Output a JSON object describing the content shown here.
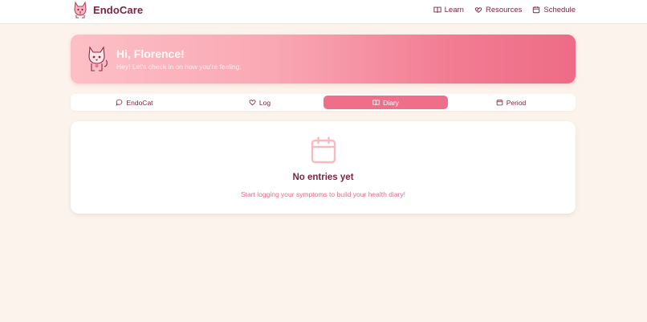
{
  "brand": {
    "name": "EndoCare"
  },
  "nav": [
    {
      "label": "Learn",
      "icon": "book-open-icon"
    },
    {
      "label": "Resources",
      "icon": "hand-heart-icon"
    },
    {
      "label": "Schedule",
      "icon": "calendar-icon"
    }
  ],
  "hero": {
    "title": "Hi, Florence!",
    "subtitle": "Hey! Let's check in on how you're feeling."
  },
  "tabs": [
    {
      "label": "EndoCat",
      "icon": "chat-bubble-icon",
      "active": false
    },
    {
      "label": "Log",
      "icon": "heart-icon",
      "active": false
    },
    {
      "label": "Diary",
      "icon": "book-open-icon",
      "active": true
    },
    {
      "label": "Period",
      "icon": "calendar-icon",
      "active": false
    }
  ],
  "empty_state": {
    "title": "No entries yet",
    "subtitle": "Start logging your symptoms to build your health diary!",
    "icon": "calendar-icon"
  },
  "colors": {
    "background": "#fcf3ec",
    "accent": "#ef6f8a",
    "text_dark": "#7a2440",
    "hero_start": "#fdbfc5",
    "hero_end": "#ee6b86"
  }
}
